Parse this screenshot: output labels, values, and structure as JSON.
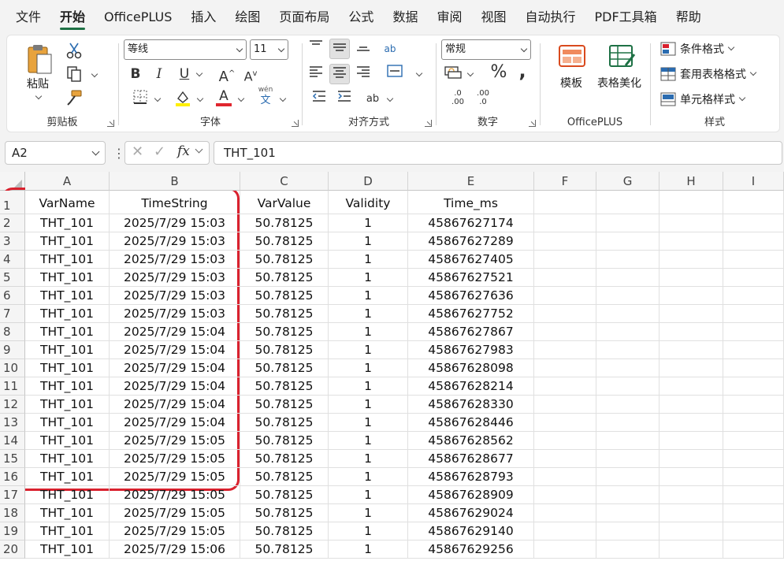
{
  "menu": [
    "文件",
    "开始",
    "OfficePLUS",
    "插入",
    "绘图",
    "页面布局",
    "公式",
    "数据",
    "审阅",
    "视图",
    "自动执行",
    "PDF工具箱",
    "帮助"
  ],
  "active_menu_index": 1,
  "ribbon": {
    "clipboard": {
      "paste_label": "粘贴",
      "group_label": "剪贴板"
    },
    "font": {
      "font_name": "等线",
      "font_size": "11",
      "group_label": "字体",
      "wen_label": "wén",
      "wen_char": "文"
    },
    "alignment": {
      "group_label": "对齐方式"
    },
    "number": {
      "format": "常规",
      "group_label": "数字"
    },
    "officeplus": {
      "template_label": "模板",
      "beautify_label": "表格美化",
      "group_label": "OfficePLUS"
    },
    "styles": {
      "conditional": "条件格式",
      "table_format": "套用表格格式",
      "cell_style": "单元格样式",
      "group_label": "样式"
    }
  },
  "formula_bar": {
    "name_box": "A2",
    "formula": "THT_101",
    "fx": "fx"
  },
  "columns": [
    "A",
    "B",
    "C",
    "D",
    "E",
    "F",
    "G",
    "H",
    "I"
  ],
  "headers": [
    "VarName",
    "TimeString",
    "VarValue",
    "Validity",
    "Time_ms"
  ],
  "rows": [
    [
      "THT_101",
      "2025/7/29 15:03",
      "50.78125",
      "1",
      "45867627174"
    ],
    [
      "THT_101",
      "2025/7/29 15:03",
      "50.78125",
      "1",
      "45867627289"
    ],
    [
      "THT_101",
      "2025/7/29 15:03",
      "50.78125",
      "1",
      "45867627405"
    ],
    [
      "THT_101",
      "2025/7/29 15:03",
      "50.78125",
      "1",
      "45867627521"
    ],
    [
      "THT_101",
      "2025/7/29 15:03",
      "50.78125",
      "1",
      "45867627636"
    ],
    [
      "THT_101",
      "2025/7/29 15:03",
      "50.78125",
      "1",
      "45867627752"
    ],
    [
      "THT_101",
      "2025/7/29 15:04",
      "50.78125",
      "1",
      "45867627867"
    ],
    [
      "THT_101",
      "2025/7/29 15:04",
      "50.78125",
      "1",
      "45867627983"
    ],
    [
      "THT_101",
      "2025/7/29 15:04",
      "50.78125",
      "1",
      "45867628098"
    ],
    [
      "THT_101",
      "2025/7/29 15:04",
      "50.78125",
      "1",
      "45867628214"
    ],
    [
      "THT_101",
      "2025/7/29 15:04",
      "50.78125",
      "1",
      "45867628330"
    ],
    [
      "THT_101",
      "2025/7/29 15:04",
      "50.78125",
      "1",
      "45867628446"
    ],
    [
      "THT_101",
      "2025/7/29 15:05",
      "50.78125",
      "1",
      "45867628562"
    ],
    [
      "THT_101",
      "2025/7/29 15:05",
      "50.78125",
      "1",
      "45867628677"
    ],
    [
      "THT_101",
      "2025/7/29 15:05",
      "50.78125",
      "1",
      "45867628793"
    ],
    [
      "THT_101",
      "2025/7/29 15:05",
      "50.78125",
      "1",
      "45867628909"
    ],
    [
      "THT_101",
      "2025/7/29 15:05",
      "50.78125",
      "1",
      "45867629024"
    ],
    [
      "THT_101",
      "2025/7/29 15:05",
      "50.78125",
      "1",
      "45867629140"
    ],
    [
      "THT_101",
      "2025/7/29 15:06",
      "50.78125",
      "1",
      "45867629256"
    ]
  ],
  "colors": {
    "accent": "#1e7145",
    "highlight": "#d9212e",
    "font_color": "#e0262f",
    "highlight_color": "#ffef00"
  }
}
